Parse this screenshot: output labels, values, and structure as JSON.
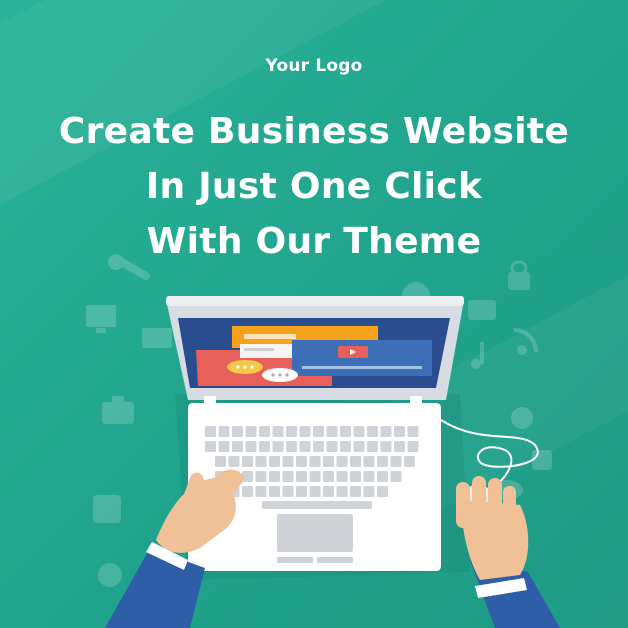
{
  "logo": {
    "text": "Your Logo"
  },
  "headline": {
    "line1": "Create Business Website",
    "line2": "In Just One Click",
    "line3": "With Our Theme"
  },
  "colors": {
    "background": "#22a88f",
    "laptop_body": "#ffffff",
    "laptop_bezel": "#cfd4da",
    "screen_bg": "#2a4d8f",
    "sleeve": "#2e5ea8",
    "skin": "#f0c197"
  },
  "icons": [
    "wrench-icon",
    "monitor-icon",
    "envelope-icon",
    "briefcase-icon",
    "cloud-icon",
    "lock-icon",
    "sun-icon",
    "music-note-icon",
    "rss-icon",
    "globe-icon",
    "clock-icon",
    "calendar-icon",
    "play-button-icon",
    "chat-bubble-icon"
  ]
}
